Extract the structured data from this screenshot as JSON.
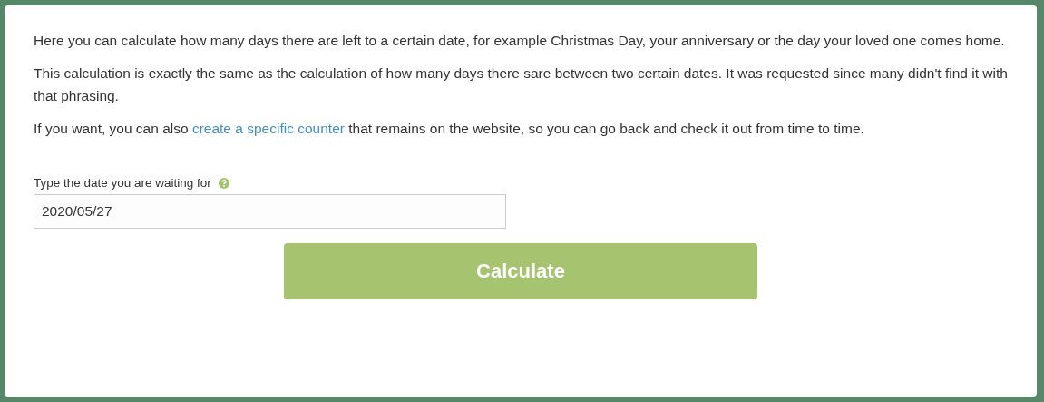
{
  "paragraphs": [
    {
      "text": "Here you can calculate how many days there are left to a certain date, for example Christmas Day, your anniversary or the day your loved one comes home."
    },
    {
      "text": "This calculation is exactly the same as the calculation of how many days there sare between two certain dates. It was requested since many didn't find it with that phrasing."
    },
    {
      "before": "If you want, you can also ",
      "link": "create a specific counter",
      "after": " that remains on the website, so you can go back and check it out from time to time."
    }
  ],
  "date_field": {
    "label": "Type the date you are waiting for",
    "value": "2020/05/27"
  },
  "button": "Calculate"
}
